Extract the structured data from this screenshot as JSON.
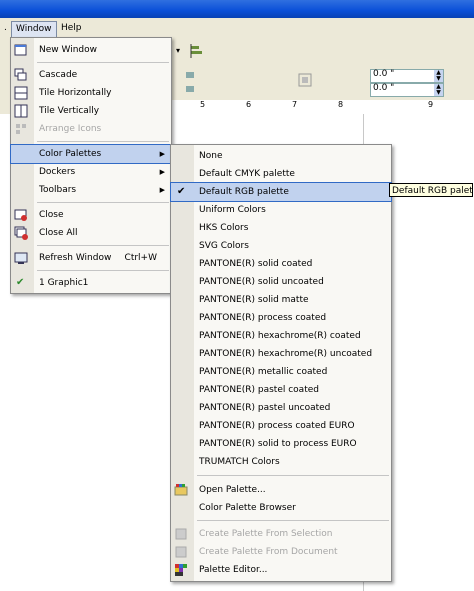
{
  "menubar": {
    "item0": ".",
    "window": "Window",
    "help": "Help"
  },
  "toolbar": {
    "x_value": "0.0 \"",
    "y_value": "0.0 \""
  },
  "ruler": {
    "ticks": [
      "5",
      "6",
      "7",
      "8",
      "9"
    ]
  },
  "window_menu": {
    "new_window": "New Window",
    "cascade": "Cascade",
    "tile_h": "Tile Horizontally",
    "tile_v": "Tile Vertically",
    "arrange": "Arrange Icons",
    "color_palettes": "Color Palettes",
    "dockers": "Dockers",
    "toolbars": "Toolbars",
    "close": "Close",
    "close_all": "Close All",
    "refresh": "Refresh Window",
    "refresh_shortcut": "Ctrl+W",
    "graphic": "1 Graphic1"
  },
  "palette_menu": {
    "items": [
      "None",
      "Default CMYK palette",
      "Default RGB palette",
      "Uniform Colors",
      "HKS Colors",
      "SVG Colors",
      "PANTONE(R) solid coated",
      "PANTONE(R) solid uncoated",
      "PANTONE(R) solid matte",
      "PANTONE(R) process coated",
      "PANTONE(R) hexachrome(R) coated",
      "PANTONE(R) hexachrome(R) uncoated",
      "PANTONE(R) metallic coated",
      "PANTONE(R) pastel coated",
      "PANTONE(R) pastel uncoated",
      "PANTONE(R) process coated EURO",
      "PANTONE(R) solid to process EURO",
      "TRUMATCH Colors"
    ],
    "open_palette": "Open Palette...",
    "browser": "Color Palette Browser",
    "from_selection": "Create Palette From Selection",
    "from_document": "Create Palette From Document",
    "editor": "Palette Editor..."
  },
  "tooltip": "Default RGB palette"
}
